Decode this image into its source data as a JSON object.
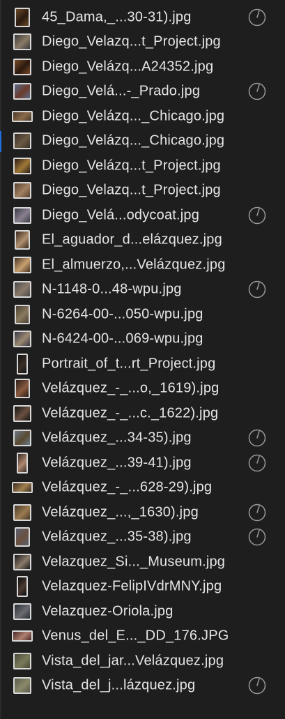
{
  "files": [
    {
      "name": "45_Dama,_...30-31).jpg",
      "thumb": "portrait",
      "tone": [
        "#6b4a2a",
        "#2a1a10"
      ],
      "loading": true
    },
    {
      "name": "Diego_Velazq...t_Project.jpg",
      "thumb": "square",
      "tone": [
        "#3a3a3a",
        "#8a7a66"
      ],
      "loading": false
    },
    {
      "name": "Diego_Velázq...A24352.jpg",
      "thumb": "square",
      "tone": [
        "#7a4a26",
        "#2b1a10"
      ],
      "loading": false
    },
    {
      "name": "Diego_Velá...-_Prado.jpg",
      "thumb": "square",
      "tone": [
        "#5a6a8a",
        "#6a3a2a"
      ],
      "loading": true
    },
    {
      "name": "Diego_Velázq..._Chicago.jpg",
      "thumb": "wide",
      "tone": [
        "#4a3a2a",
        "#8a6a4a"
      ],
      "loading": false
    },
    {
      "name": "Diego_Velázq..._Chicago.jpg",
      "thumb": "square",
      "tone": [
        "#3a3026",
        "#6a5a44"
      ],
      "loading": false
    },
    {
      "name": "Diego_Velázq...t_Project.jpg",
      "thumb": "square",
      "tone": [
        "#2a1e14",
        "#a07838"
      ],
      "loading": false
    },
    {
      "name": "Diego_Velazq...t_Project.jpg",
      "thumb": "square",
      "tone": [
        "#5a4030",
        "#a08060"
      ],
      "loading": false
    },
    {
      "name": "Diego_Velá...odycoat.jpg",
      "thumb": "square",
      "tone": [
        "#3a3a44",
        "#8a8090"
      ],
      "loading": true
    },
    {
      "name": "El_aguador_d...elázquez.jpg",
      "thumb": "portrait",
      "tone": [
        "#3a2a1c",
        "#b09070"
      ],
      "loading": false
    },
    {
      "name": "El_almuerzo,...Velázquez.jpg",
      "thumb": "square",
      "tone": [
        "#4a3424",
        "#c8a070"
      ],
      "loading": false
    },
    {
      "name": "N-1148-0...48-wpu.jpg",
      "thumb": "square",
      "tone": [
        "#4a4a4a",
        "#8a7a6a"
      ],
      "loading": true
    },
    {
      "name": "N-6264-00-...050-wpu.jpg",
      "thumb": "portrait",
      "tone": [
        "#4a4034",
        "#8a7a60"
      ],
      "loading": false
    },
    {
      "name": "N-6424-00-...069-wpu.jpg",
      "thumb": "square",
      "tone": [
        "#3a3a4a",
        "#9a8870"
      ],
      "loading": false
    },
    {
      "name": "Portrait_of_t...rt_Project.jpg",
      "thumb": "tall",
      "tone": [
        "#141414",
        "#3a2e26"
      ],
      "loading": false
    },
    {
      "name": "Velázquez_-_...o,_1619).jpg",
      "thumb": "portrait",
      "tone": [
        "#2a1e18",
        "#8a5a40"
      ],
      "loading": false
    },
    {
      "name": "Velázquez_-_...c._1622).jpg",
      "thumb": "square",
      "tone": [
        "#141414",
        "#6a5040"
      ],
      "loading": false
    },
    {
      "name": "Velázquez_...34-35).jpg",
      "thumb": "square",
      "tone": [
        "#6a7a8a",
        "#5a4a30"
      ],
      "loading": true
    },
    {
      "name": "Velázquez_...39-41).jpg",
      "thumb": "tall",
      "tone": [
        "#3a2e28",
        "#b08870"
      ],
      "loading": true
    },
    {
      "name": "Velázquez_-_...628-29).jpg",
      "thumb": "wide",
      "tone": [
        "#3a2a1e",
        "#a08050"
      ],
      "loading": false
    },
    {
      "name": "Velázquez_...,_1630).jpg",
      "thumb": "square",
      "tone": [
        "#4a3a2a",
        "#9a7a50"
      ],
      "loading": true
    },
    {
      "name": "Velázquez_...35-38).jpg",
      "thumb": "portrait",
      "tone": [
        "#5a6070",
        "#6a5040"
      ],
      "loading": true
    },
    {
      "name": "Velazquez_Si..._Museum.jpg",
      "thumb": "square",
      "tone": [
        "#1a1a1a",
        "#8a7a6a"
      ],
      "loading": false
    },
    {
      "name": "Velazquez-FelipIVdrMNY.jpg",
      "thumb": "tall",
      "tone": [
        "#0e0e0e",
        "#4a3a30"
      ],
      "loading": false
    },
    {
      "name": "Velazquez-Oriola.jpg",
      "thumb": "square",
      "tone": [
        "#2a3038",
        "#6a6a70"
      ],
      "loading": false
    },
    {
      "name": "Venus_del_E..._DD_176.JPG",
      "thumb": "wide",
      "tone": [
        "#4a2a2a",
        "#b08070"
      ],
      "loading": false
    },
    {
      "name": "Vista_del_jar...Velázquez.jpg",
      "thumb": "square",
      "tone": [
        "#4a4a3a",
        "#7a7a5a"
      ],
      "loading": false
    },
    {
      "name": "Vista_del_j...lázquez.jpg",
      "thumb": "square",
      "tone": [
        "#5a5a4a",
        "#8a8a6a"
      ],
      "loading": true
    }
  ]
}
